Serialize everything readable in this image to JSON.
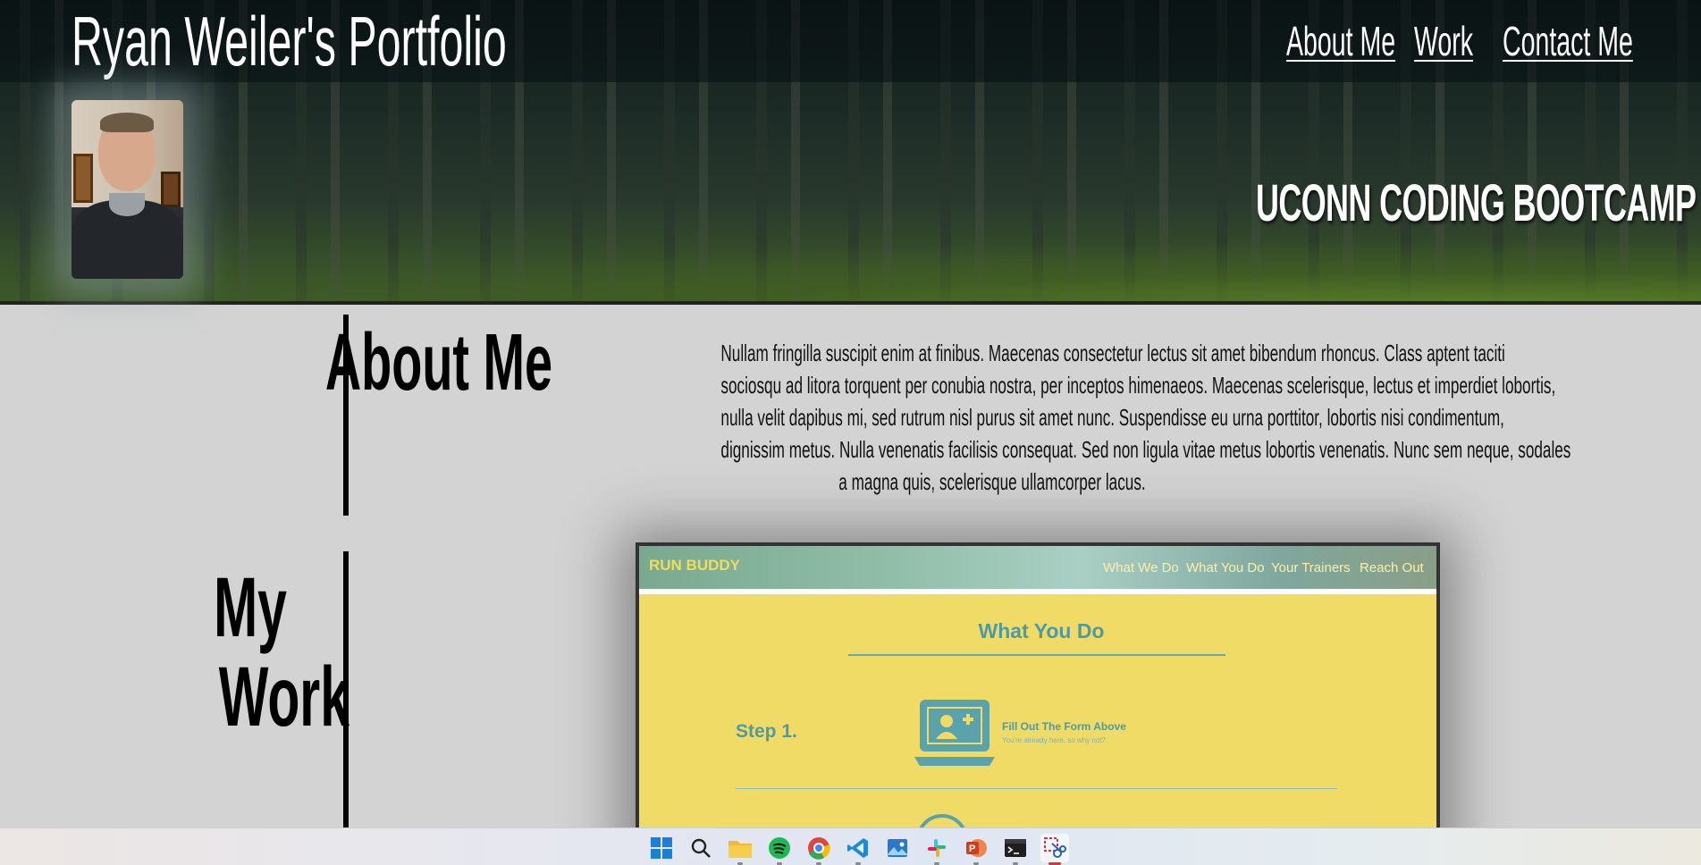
{
  "header": {
    "site_title": "Ryan Weiler's Portfolio",
    "nav": [
      {
        "label": "About Me"
      },
      {
        "label": "Work"
      },
      {
        "label": "Contact Me"
      }
    ],
    "bootcamp": "UCONN CODING BOOTCAMP"
  },
  "about": {
    "title": "About Me",
    "text_lines": [
      "Nullam fringilla suscipit enim at finibus. Maecenas consectetur lectus sit amet bibendum rhoncus. Class aptent taciti",
      "sociosqu ad litora torquent per conubia nostra, per inceptos himenaeos. Maecenas scelerisque, lectus et imperdiet lobortis,",
      "nulla velit dapibus mi, sed rutrum nisl purus sit amet nunc. Suspendisse eu urna porttitor, lobortis nisi condimentum,",
      "dignissim metus. Nulla venenatis facilisis consequat. Sed non ligula vitae metus lobortis venenatis. Nunc sem neque, sodales",
      "a magna quis, scelerisque ullamcorper lacus."
    ]
  },
  "work": {
    "title_line1": "My",
    "title_line2": "Work",
    "project": {
      "logo": "RUN BUDDY",
      "nav": [
        "What We Do",
        "What You Do",
        "Your Trainers",
        "Reach Out"
      ],
      "section_title": "What You Do",
      "step_label": "Step 1.",
      "step_title": "Fill Out The Form Above",
      "step_subtitle": "You're already here, so why not?"
    }
  },
  "taskbar": {
    "icons": [
      "windows-start-icon",
      "search-icon",
      "file-explorer-icon",
      "spotify-icon",
      "chrome-icon",
      "vscode-icon",
      "photos-icon",
      "slack-icon",
      "powerpoint-icon",
      "terminal-icon",
      "snipping-tool-icon"
    ],
    "colors": {
      "accent": "#d33333"
    }
  }
}
